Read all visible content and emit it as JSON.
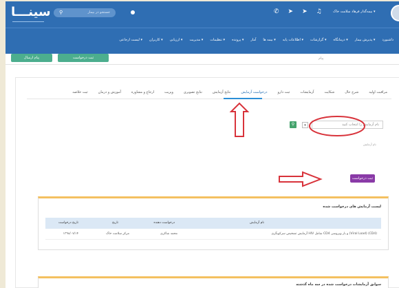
{
  "header": {
    "logo": "سینـــا",
    "search_placeholder": "جستجو در بیمار",
    "user_label": "بیمه‌گذار فرهاد سلامت خاک ▾"
  },
  "nav": {
    "items": [
      "داشبورد",
      "پذیرش بیمار ▾",
      "درمانگاه ▾",
      "گزارشات ▾",
      "اطلاعات پایه ▾",
      "بیمه ها ▾",
      "آمار",
      "پرونده ▾",
      "تنظیمات ▾",
      "مدیریت ▾",
      "ارزیابی ▾",
      "کاربران ▾",
      "لیست ارجاعی ▾"
    ]
  },
  "subbar": {
    "btn1": "پیام ارسال",
    "btn2": "ثبت درخواست",
    "right_text": "پیام"
  },
  "tabs": [
    "مراقبت اولیه",
    "شرح حال",
    "شکایت",
    "آزمایشات",
    "ثبت دارو",
    "درخواست آزمایش",
    "نتایج آزمایش",
    "نتایج تصویری",
    "ویزیت",
    "ارجاع و مشاوره",
    "آموزش و درمان",
    "ثبت خلاصه"
  ],
  "form": {
    "select_placeholder": "نام آزمایش را انتخاب کنید",
    "hint": "نام آزمایش"
  },
  "action": {
    "submit_label": "ثبت درخواست"
  },
  "card": {
    "title": "لیست آزمایش های درخواست شده",
    "headers": [
      "نام آزمایش",
      "درخواست دهنده",
      "تاریخ",
      "تاریخ درخواست"
    ],
    "row": [
      "آزمایش تشخیص سرکوبگری HIV شامل CD4 و بار ویروسی (Viral Load) (CD4)",
      "محمد شاکری",
      "مرکز سلامت خاک",
      "۱۳۹۸/۰۷/۱۴"
    ]
  },
  "card2": {
    "title": "سوابق آزمایشات درخواست شده در سه ماه گذشته"
  }
}
